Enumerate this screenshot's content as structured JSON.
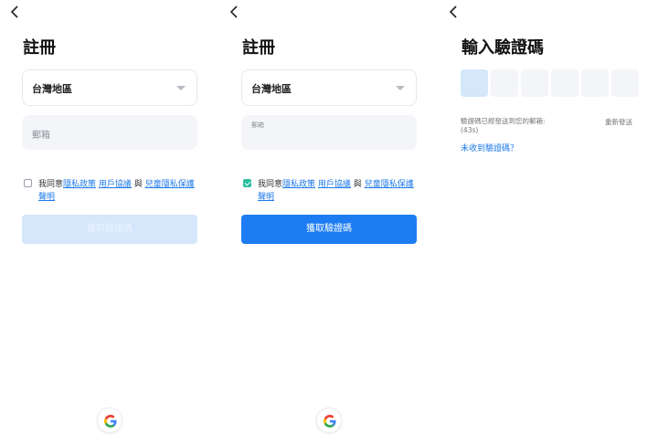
{
  "colors": {
    "accent": "#1d7cf2",
    "link": "#1f7ae8",
    "check": "#2abf9e",
    "disabled_button": "#d6e7fb"
  },
  "screen1": {
    "title": "註冊",
    "region": "台灣地區",
    "email_placeholder": "郵箱",
    "agree_prefix": "我同意",
    "privacy_policy": "隱私政策",
    "user_agreement": "用戶協議",
    "and": "與",
    "children_privacy": "兒童隱私保護聲明",
    "checkbox_checked": false,
    "button_label": "獲取驗證碼",
    "button_enabled": false
  },
  "screen2": {
    "title": "註冊",
    "region": "台灣地區",
    "email_label": "郵箱",
    "agree_prefix": "我同意",
    "privacy_policy": "隱私政策",
    "user_agreement": "用戶協議",
    "and": "與",
    "children_privacy": "兒童隱私保護聲明",
    "checkbox_checked": true,
    "button_label": "獲取驗證碼",
    "button_enabled": true
  },
  "screen3": {
    "title": "輸入驗證碼",
    "code_boxes": [
      "",
      "",
      "",
      "",
      "",
      ""
    ],
    "sent_message": "驗證碼已經發送到您的郵箱:",
    "countdown": "(43s)",
    "resend": "重新發送",
    "not_received": "未收到驗證碼？"
  },
  "icons": {
    "back": "chevron-left-icon",
    "google": "google-logo-icon",
    "dropdown": "caret-down-icon"
  }
}
